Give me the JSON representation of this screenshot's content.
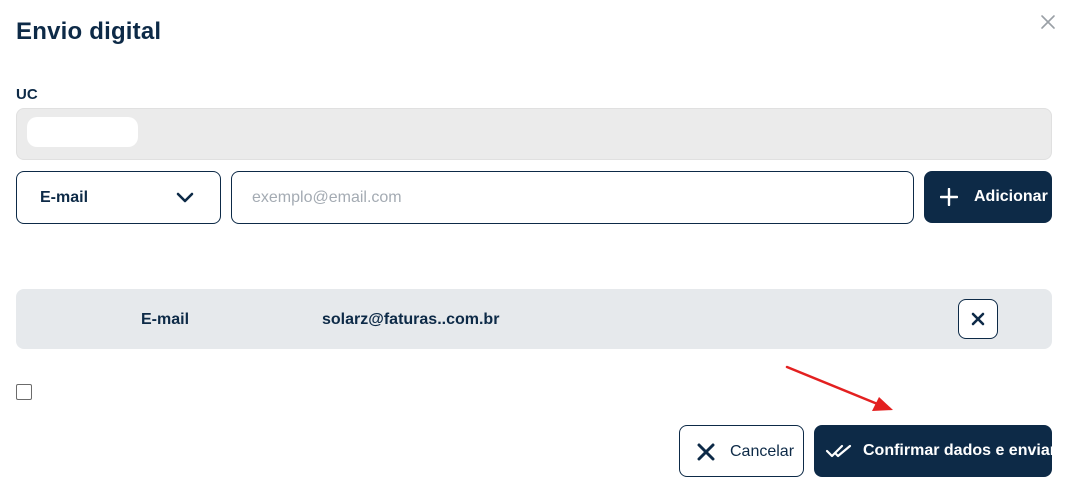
{
  "dialog": {
    "title": "Envio digital"
  },
  "uc": {
    "label": "UC"
  },
  "form": {
    "contact_type": "E-mail",
    "email_placeholder": "exemplo@email.com",
    "email_value": "",
    "add_label": "Adicionar"
  },
  "contacts": [
    {
      "type": "E-mail",
      "value": "solarz@faturas..com.br"
    }
  ],
  "footer": {
    "cancel_label": "Cancelar",
    "confirm_label": "Confirmar dados e enviar"
  },
  "colors": {
    "primary": "#0d2a47",
    "row_background": "#e6e9ec",
    "annotation_arrow": "#e32020"
  },
  "icons": {
    "close": "close-icon",
    "chevron": "chevron-down-icon",
    "add": "plus-icon",
    "remove": "close-icon",
    "cancel": "close-icon",
    "confirm": "double-check-icon"
  }
}
